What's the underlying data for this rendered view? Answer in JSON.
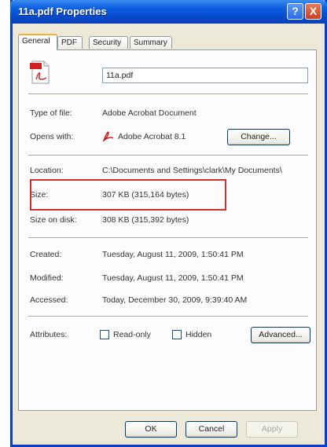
{
  "window": {
    "title": "11a.pdf Properties",
    "help_glyph": "?",
    "close_glyph": "X"
  },
  "tabs": [
    {
      "label": "General",
      "active": true
    },
    {
      "label": "PDF"
    },
    {
      "label": "Security"
    },
    {
      "label": "Summary"
    }
  ],
  "general": {
    "file_icon": "pdf-file-icon",
    "file_name": "11a.pdf",
    "type_label": "Type of file:",
    "type_value": "Adobe Acrobat Document",
    "opens_label": "Opens with:",
    "opens_value": "Adobe Acrobat 8.1",
    "change_button": "Change...",
    "location_label": "Location:",
    "location_value": "C:\\Documents and Settings\\clark\\My Documents\\",
    "size_label": "Size:",
    "size_value": "307 KB (315,164 bytes)",
    "size_on_disk_label": "Size on disk:",
    "size_on_disk_value": "308 KB (315,392 bytes)",
    "created_label": "Created:",
    "created_value": "Tuesday, August 11, 2009, 1:50:41 PM",
    "modified_label": "Modified:",
    "modified_value": "Tuesday, August 11, 2009, 1:50:41 PM",
    "accessed_label": "Accessed:",
    "accessed_value": "Today, December 30, 2009, 9:39:40 AM",
    "attributes_label": "Attributes:",
    "read_only_label": "Read-only",
    "hidden_label": "Hidden",
    "advanced_button": "Advanced..."
  },
  "footer": {
    "ok": "OK",
    "cancel": "Cancel",
    "apply": "Apply"
  },
  "colors": {
    "title_bar": "#0a5fe0",
    "highlight": "#d03030",
    "dialog_bg": "#ece9d8"
  }
}
